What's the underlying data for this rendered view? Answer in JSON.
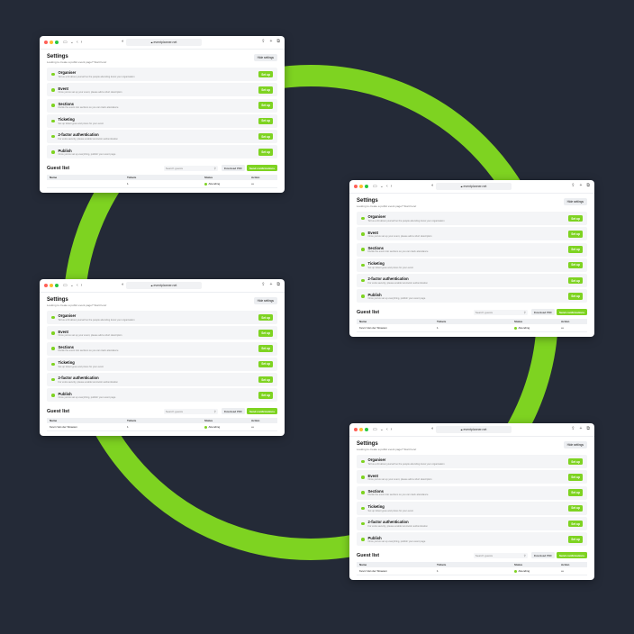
{
  "colors": {
    "background": "#242a37",
    "accent": "#7ed321"
  },
  "windows": [
    {
      "url": "eventplanner.net",
      "settings_title": "Settings",
      "settings_subtitle": "Looking to create a public event page? Start here!",
      "hide_label": "Hide settings",
      "items": [
        {
          "name": "Organiser",
          "desc": "Tell us a bit about yourself so the people attending know your organisation",
          "button": "Set up"
        },
        {
          "name": "Event",
          "desc": "Once you've set up your event, please add a short description",
          "button": "Set up"
        },
        {
          "name": "Sections",
          "desc": "Divide the event into sections so you can track attendance",
          "button": "Set up"
        },
        {
          "name": "Ticketing",
          "desc": "Set up ticket types and prices for your event",
          "button": "Set up"
        },
        {
          "name": "2-factor authentication",
          "desc": "For extra security, please enable two-factor authentication",
          "button": "Set up"
        },
        {
          "name": "Publish",
          "desc": "Once you've set up everything, publish your event page",
          "button": "Set up"
        }
      ],
      "guest_list_title": "Guest list",
      "search_placeholder": "Search guests",
      "download_label": "Download PDF",
      "send_label": "Send confirmations",
      "columns": [
        "Name",
        "Tickets",
        "Status",
        "Action"
      ],
      "rows": [
        {
          "name": "",
          "tickets": "1",
          "status": "Attending",
          "action": "•••"
        }
      ]
    },
    {
      "url": "eventplanner.net",
      "settings_title": "Settings",
      "settings_subtitle": "Looking to create a public event page? Start here!",
      "hide_label": "Hide settings",
      "items": [
        {
          "name": "Organiser",
          "desc": "Tell us a bit about yourself so the people attending know your organisation",
          "button": "Set up"
        },
        {
          "name": "Event",
          "desc": "Once you've set up your event, please add a short description",
          "button": "Set up"
        },
        {
          "name": "Sections",
          "desc": "Divide the event into sections so you can track attendance",
          "button": "Set up"
        },
        {
          "name": "Ticketing",
          "desc": "Set up ticket types and prices for your event",
          "button": "Set up"
        },
        {
          "name": "2-factor authentication",
          "desc": "For extra security, please enable two-factor authentication",
          "button": "Set up"
        },
        {
          "name": "Publish",
          "desc": "Once you've set up everything, publish your event page",
          "button": "Set up"
        }
      ],
      "guest_list_title": "Guest list",
      "search_placeholder": "Search guests",
      "download_label": "Download PDF",
      "send_label": "Send confirmations",
      "columns": [
        "Name",
        "Tickets",
        "Status",
        "Action"
      ],
      "rows": [
        {
          "name": "Kevin Van der Straeten",
          "tickets": "1",
          "status": "Attending",
          "action": "•••"
        }
      ]
    },
    {
      "url": "eventplanner.net",
      "settings_title": "Settings",
      "settings_subtitle": "Looking to create a public event page? Start here!",
      "hide_label": "Hide settings",
      "items": [
        {
          "name": "Organiser",
          "desc": "Tell us a bit about yourself so the people attending know your organisation",
          "button": "Set up"
        },
        {
          "name": "Event",
          "desc": "Once you've set up your event, please add a short description",
          "button": "Set up"
        },
        {
          "name": "Sections",
          "desc": "Divide the event into sections so you can track attendance",
          "button": "Set up"
        },
        {
          "name": "Ticketing",
          "desc": "Set up ticket types and prices for your event",
          "button": "Set up"
        },
        {
          "name": "2-factor authentication",
          "desc": "For extra security, please enable two-factor authentication",
          "button": "Set up"
        },
        {
          "name": "Publish",
          "desc": "Once you've set up everything, publish your event page",
          "button": "Set up"
        }
      ],
      "guest_list_title": "Guest list",
      "search_placeholder": "Search guests",
      "download_label": "Download PDF",
      "send_label": "Send confirmations",
      "columns": [
        "Name",
        "Tickets",
        "Status",
        "Action"
      ],
      "rows": [
        {
          "name": "Kevin Van der Straeten",
          "tickets": "1",
          "status": "Attending",
          "action": "•••"
        }
      ]
    },
    {
      "url": "eventplanner.net",
      "settings_title": "Settings",
      "settings_subtitle": "Looking to create a public event page? Start here!",
      "hide_label": "Hide settings",
      "items": [
        {
          "name": "Organiser",
          "desc": "Tell us a bit about yourself so the people attending know your organisation",
          "button": "Set up"
        },
        {
          "name": "Event",
          "desc": "Once you've set up your event, please add a short description",
          "button": "Set up"
        },
        {
          "name": "Sections",
          "desc": "Divide the event into sections so you can track attendance",
          "button": "Set up"
        },
        {
          "name": "Ticketing",
          "desc": "Set up ticket types and prices for your event",
          "button": "Set up"
        },
        {
          "name": "2-factor authentication",
          "desc": "For extra security, please enable two-factor authentication",
          "button": "Set up"
        },
        {
          "name": "Publish",
          "desc": "Once you've set up everything, publish your event page",
          "button": "Set up"
        }
      ],
      "guest_list_title": "Guest list",
      "search_placeholder": "Search guests",
      "download_label": "Download PDF",
      "send_label": "Send confirmations",
      "columns": [
        "Name",
        "Tickets",
        "Status",
        "Action"
      ],
      "rows": [
        {
          "name": "Kevin Van der Straeten",
          "tickets": "1",
          "status": "Attending",
          "action": "•••"
        }
      ]
    }
  ]
}
